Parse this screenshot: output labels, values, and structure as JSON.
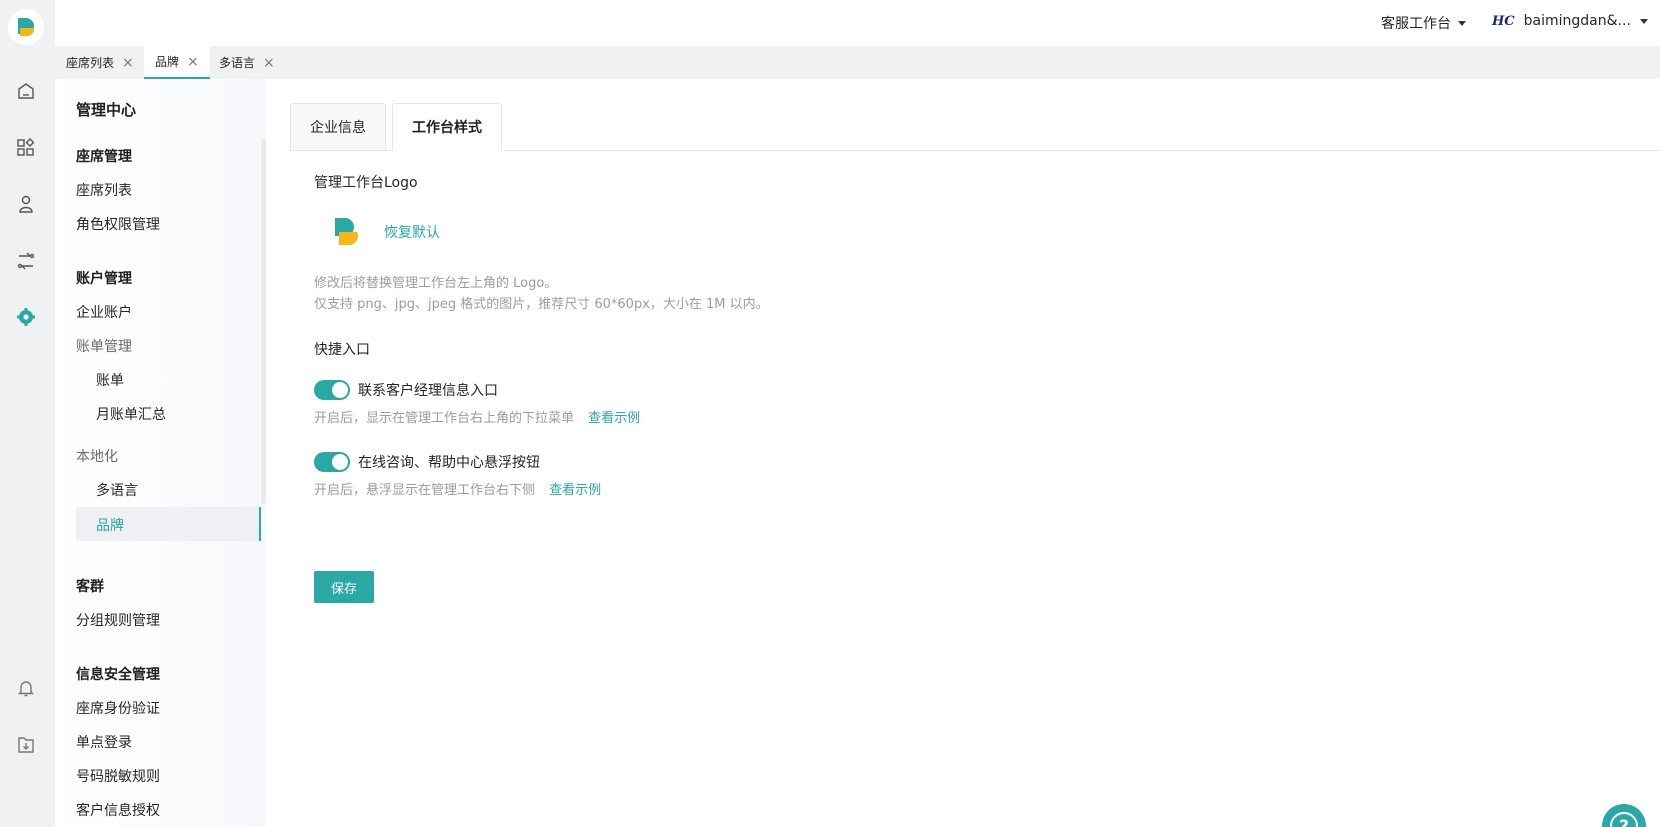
{
  "colors": {
    "accent": "#29a8a5",
    "logo_yellow": "#f5b619"
  },
  "rail": {
    "icons": [
      "app-logo-icon",
      "home-icon",
      "apps-icon",
      "user-icon",
      "route-icon",
      "gear-icon",
      "bell-icon",
      "download-icon"
    ]
  },
  "header": {
    "workspace": "客服工作台",
    "user_logo": "HC",
    "user_name": "baimingdan&..."
  },
  "page_tabs": [
    {
      "label": "座席列表"
    },
    {
      "label": "品牌"
    },
    {
      "label": "多语言"
    }
  ],
  "sidebar": {
    "title": "管理中心",
    "groups": {
      "seat": {
        "title": "座席管理",
        "items": [
          "座席列表",
          "角色权限管理"
        ]
      },
      "account": {
        "title": "账户管理",
        "items": [
          "企业账户"
        ],
        "billing": "账单管理",
        "billing_items": [
          "账单",
          "月账单汇总"
        ]
      },
      "localization": {
        "title": "本地化",
        "items": [
          "多语言",
          "品牌"
        ]
      },
      "customer": {
        "title": "客群",
        "items": [
          "分组规则管理"
        ]
      },
      "security": {
        "title": "信息安全管理",
        "items": [
          "座席身份验证",
          "单点登录",
          "号码脱敏规则",
          "客户信息授权"
        ]
      }
    }
  },
  "content_tabs": [
    {
      "label": "企业信息"
    },
    {
      "label": "工作台样式"
    }
  ],
  "logo_section": {
    "title": "管理工作台Logo",
    "restore": "恢复默认",
    "hint1": "修改后将替换管理工作台左上角的 Logo。",
    "hint2": "仅支持 png、jpg、jpeg 格式的图片，推荐尺寸 60*60px，大小在 1M 以内。"
  },
  "shortcut": {
    "title": "快捷入口",
    "items": [
      {
        "label": "联系客户经理信息入口",
        "on": true,
        "hint": "开启后，显示在管理工作台右上角的下拉菜单",
        "link": "查看示例"
      },
      {
        "label": "在线咨询、帮助中心悬浮按钮",
        "on": true,
        "hint": "开启后，悬浮显示在管理工作台右下侧",
        "link": "查看示例"
      }
    ]
  },
  "save_label": "保存",
  "help_icon": "help-icon"
}
